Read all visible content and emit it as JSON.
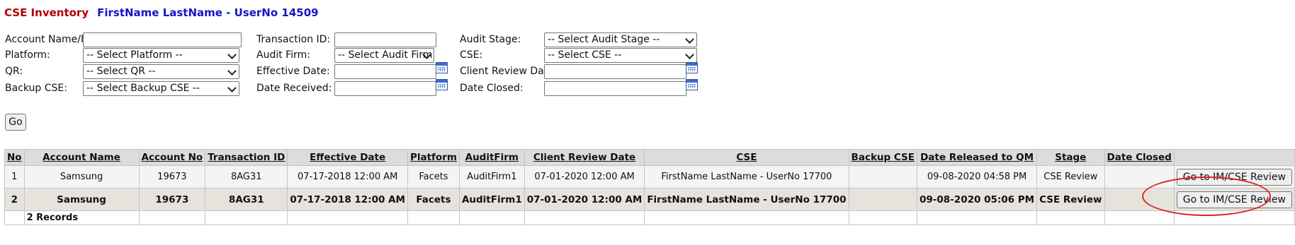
{
  "header": {
    "app_title": "CSE Inventory",
    "user": "FirstName LastName - UserNo 14509"
  },
  "filters": {
    "account_label": "Account Name/No:",
    "platform_label": "Platform:",
    "platform_value": "-- Select Platform --",
    "qr_label": "QR:",
    "qr_value": "-- Select QR --",
    "backup_cse_label": "Backup CSE:",
    "backup_cse_value": "-- Select Backup CSE --",
    "transaction_label": "Transaction ID:",
    "audit_firm_label": "Audit Firm:",
    "audit_firm_value": "-- Select Audit Firm --",
    "effective_date_label": "Effective Date:",
    "date_received_label": "Date Received:",
    "audit_stage_label": "Audit Stage:",
    "audit_stage_value": "-- Select Audit Stage --",
    "cse_label": "CSE:",
    "cse_value": "-- Select CSE --",
    "client_review_label": "Client Review Date:",
    "date_closed_label": "Date Closed:",
    "go_label": "Go"
  },
  "table": {
    "headers": [
      "No",
      "Account Name",
      "Account No",
      "Transaction ID",
      "Effective Date",
      "Platform",
      "AuditFirm",
      "Client Review Date",
      "CSE",
      "Backup CSE",
      "Date Released to QM",
      "Stage",
      "Date Closed",
      ""
    ],
    "rows": [
      {
        "no": "1",
        "account_name": "Samsung",
        "account_no": "19673",
        "transaction_id": "8AG31",
        "effective_date": "07-17-2018 12:00 AM",
        "platform": "Facets",
        "audit_firm": "AuditFirm1",
        "client_review_date": "07-01-2020 12:00 AM",
        "cse": "FirstName LastName - UserNo 17700",
        "backup_cse": "",
        "date_released": "09-08-2020 04:58 PM",
        "stage": "CSE Review",
        "date_closed": "",
        "action": "Go to IM/CSE Review"
      },
      {
        "no": "2",
        "account_name": "Samsung",
        "account_no": "19673",
        "transaction_id": "8AG31",
        "effective_date": "07-17-2018 12:00 AM",
        "platform": "Facets",
        "audit_firm": "AuditFirm1",
        "client_review_date": "07-01-2020 12:00 AM",
        "cse": "FirstName LastName - UserNo 17700",
        "backup_cse": "",
        "date_released": "09-08-2020 05:06 PM",
        "stage": "CSE Review",
        "date_closed": "",
        "action": "Go to IM/CSE Review"
      }
    ],
    "footer": "2 Records"
  }
}
